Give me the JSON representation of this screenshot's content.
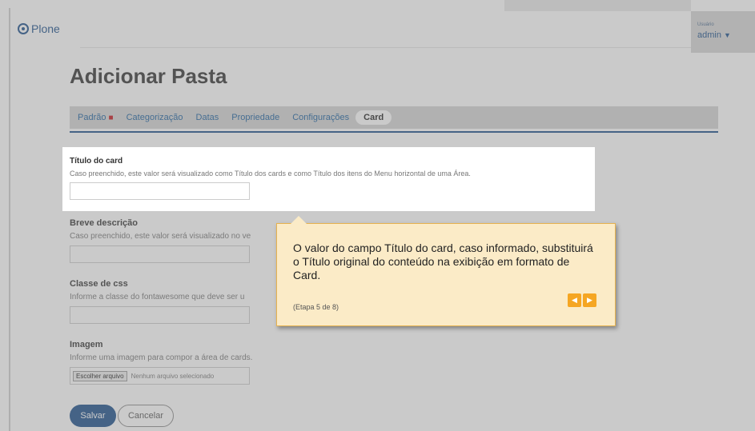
{
  "header": {
    "logo": "Plone",
    "user_caption": "Usuário",
    "user_name": "admin",
    "user_caret": "▼"
  },
  "page": {
    "title": "Adicionar Pasta"
  },
  "tabs": [
    {
      "label": "Padrão",
      "required_mark": "■"
    },
    {
      "label": "Categorização"
    },
    {
      "label": "Datas"
    },
    {
      "label": "Propriedade"
    },
    {
      "label": "Configurações"
    },
    {
      "label": "Card",
      "active": true
    }
  ],
  "fields": {
    "card_title": {
      "label": "Título do card",
      "help": "Caso preenchido, este valor será visualizado como Título dos cards e como Título dos itens do Menu horizontal de uma Área.",
      "value": ""
    },
    "short_description": {
      "label": "Breve descrição",
      "help": "Caso preenchido, este valor será visualizado no ve",
      "value": ""
    },
    "css_class": {
      "label": "Classe de css",
      "help": "Informe a classe do fontawesome que deve ser u",
      "value": ""
    },
    "image": {
      "label": "Imagem",
      "help": "Informe uma imagem para compor a área de cards.",
      "file_button": "Escolher arquivo",
      "file_status": "Nenhum arquivo selecionado"
    }
  },
  "actions": {
    "save": "Salvar",
    "cancel": "Cancelar"
  },
  "tour": {
    "text": "O valor do campo Título do card, caso informado, substituirá o Título original do conteúdo na exibição em formato de Card.",
    "step": "(Etapa 5 de 8)",
    "prev_glyph": "◀",
    "next_glyph": "▶"
  },
  "colors": {
    "brand": "#1a4f8b",
    "popover_bg": "#fbebc7",
    "nav_accent": "#f5a623",
    "required": "#c4161c"
  }
}
